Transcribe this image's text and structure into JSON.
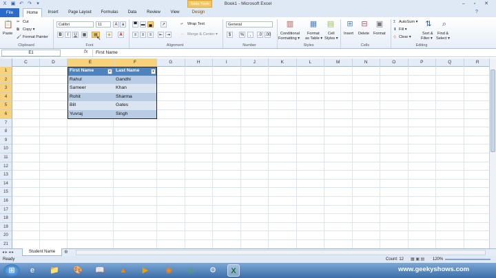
{
  "window": {
    "title": "Book1 - Microsoft Excel",
    "context_tab": "Table Tools"
  },
  "ribbon": {
    "file_tab": "File",
    "tabs": [
      "Home",
      "Insert",
      "Page Layout",
      "Formulas",
      "Data",
      "Review",
      "View",
      "Design"
    ],
    "clipboard": {
      "paste": "Paste",
      "cut": "Cut",
      "copy": "Copy ▾",
      "format_painter": "Format Painter",
      "group": "Clipboard"
    },
    "font": {
      "name": "Calibri",
      "size": "11",
      "group": "Font"
    },
    "alignment": {
      "wrap": "Wrap Text",
      "merge": "Merge & Center ▾",
      "group": "Alignment"
    },
    "number": {
      "format": "General",
      "group": "Number"
    },
    "styles": {
      "cond": "Conditional",
      "cond2": "Formatting ▾",
      "fmt": "Format",
      "fmt2": "as Table ▾",
      "cell": "Cell",
      "cell2": "Styles ▾",
      "group": "Styles"
    },
    "cells": {
      "insert": "Insert",
      "delete": "Delete",
      "format": "Format",
      "group": "Cells"
    },
    "editing": {
      "autosum": "AutoSum ▾",
      "fill": "Fill ▾",
      "clear": "Clear ▾",
      "sort": "Sort &",
      "sort2": "Filter ▾",
      "find": "Find &",
      "find2": "Select ▾",
      "group": "Editing"
    }
  },
  "formula_bar": {
    "name_box": "E1",
    "fx": "fx",
    "content": "First Name"
  },
  "grid": {
    "columns": [
      "C",
      "D",
      "E",
      "F",
      "G",
      "H",
      "I",
      "J",
      "K",
      "L",
      "M",
      "N",
      "O",
      "P",
      "Q",
      "R"
    ],
    "rows": [
      "1",
      "2",
      "3",
      "4",
      "5",
      "6",
      "7",
      "8",
      "9",
      "10",
      "11",
      "12",
      "13",
      "14",
      "15",
      "16",
      "17",
      "18",
      "19",
      "20",
      "21"
    ]
  },
  "table": {
    "headers": [
      "First Name",
      "Last Name"
    ],
    "rows": [
      [
        "Rahul",
        "Gandhi"
      ],
      [
        "Sameer",
        "Khan"
      ],
      [
        "Rohit",
        "Sharma"
      ],
      [
        "Bill",
        "Gates"
      ],
      [
        "Yuvraj",
        "Singh"
      ]
    ]
  },
  "sheet_tab": "Student Name",
  "status": {
    "ready": "Ready",
    "count": "Count: 12",
    "zoom": "120%"
  },
  "watermark": "www.geekyshows.com"
}
